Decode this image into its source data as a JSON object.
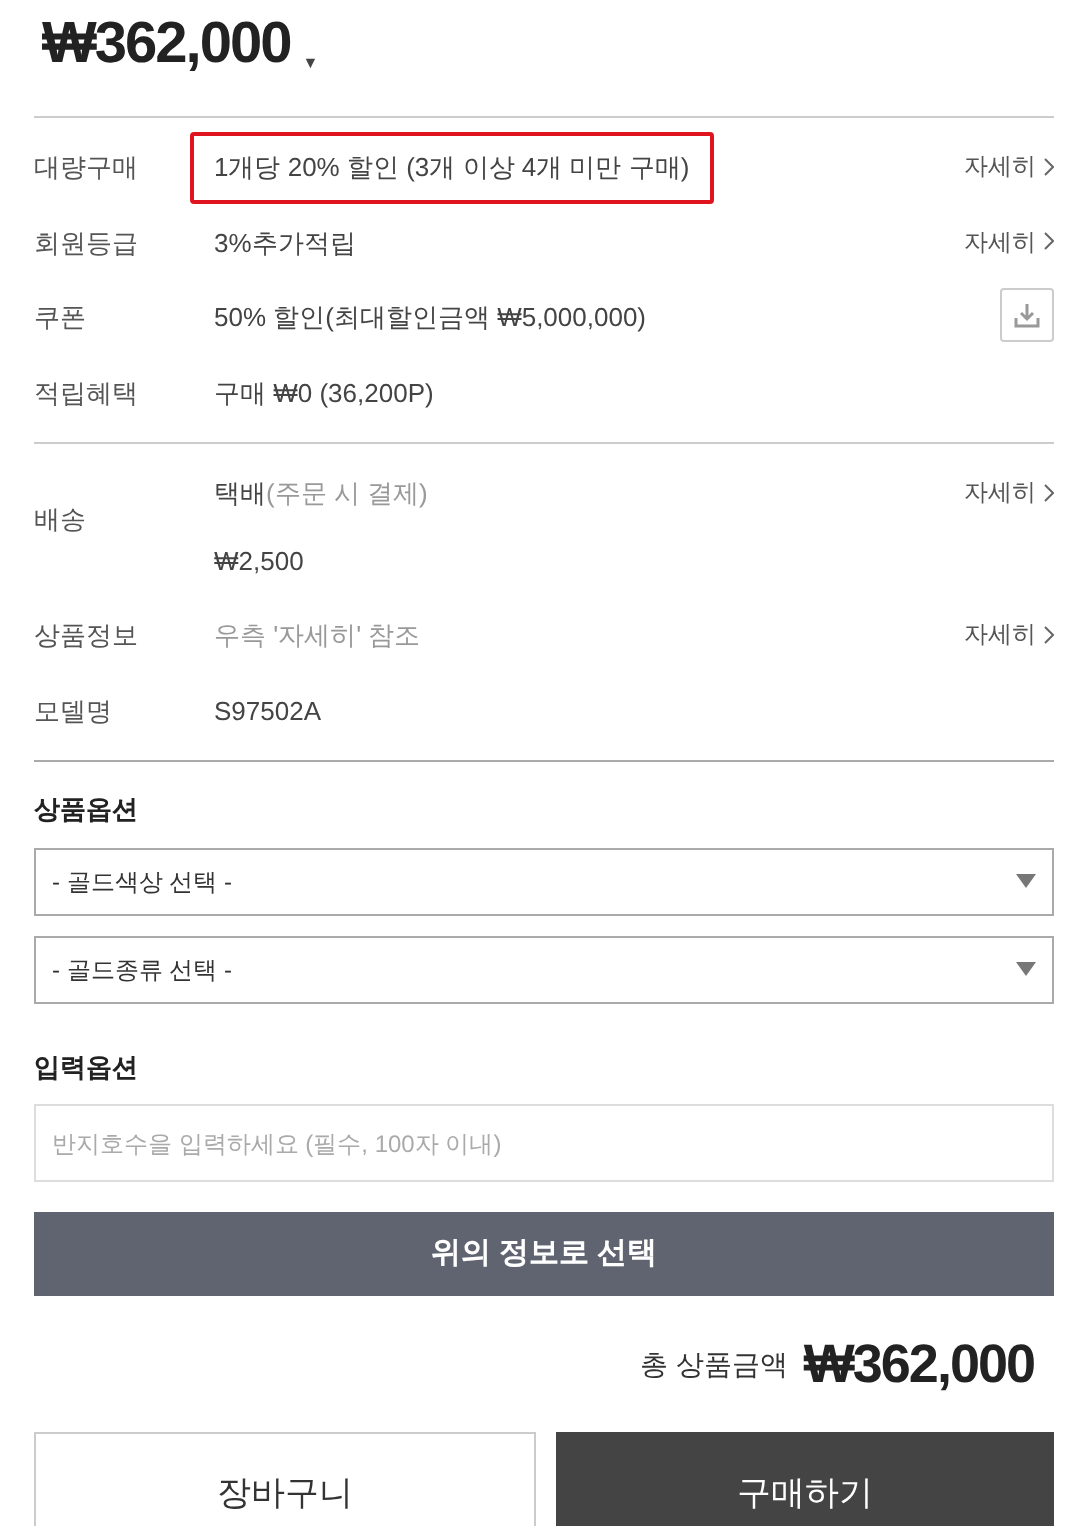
{
  "price": "₩362,000",
  "price_caret": "▼",
  "info_rows": [
    {
      "label": "대량구매",
      "kind": "text",
      "highlighted": true,
      "muted": false,
      "lines": [
        "1개당 20% 할인 (3개 이상 4개 미만 구매)"
      ],
      "detail": "자세히"
    },
    {
      "label": "회원등급",
      "kind": "text",
      "highlighted": false,
      "muted": false,
      "lines": [
        "3%추가적립"
      ],
      "detail": "자세히"
    },
    {
      "label": "쿠폰",
      "kind": "download",
      "highlighted": false,
      "muted": false,
      "lines": [
        "50% 할인(최대할인금액 ₩5,000,000)"
      ]
    },
    {
      "label": "적립혜택",
      "kind": "text",
      "highlighted": false,
      "muted": false,
      "lines": [
        "구매 ₩0 (36,200P)"
      ]
    }
  ],
  "info_rows_2": [
    {
      "label": "배송",
      "kind": "shipping",
      "highlighted": false,
      "muted": false,
      "method": "택배",
      "note": "(주문 시 결제)",
      "lines": [
        "₩2,500"
      ],
      "detail": "자세히"
    },
    {
      "label": "상품정보",
      "kind": "text",
      "highlighted": false,
      "muted": true,
      "lines": [
        "우측 '자세히' 참조"
      ],
      "detail": "자세히"
    },
    {
      "label": "모델명",
      "kind": "text",
      "highlighted": false,
      "muted": false,
      "lines": [
        "S97502A"
      ]
    }
  ],
  "product_options": {
    "title": "상품옵션",
    "selects": [
      "- 골드색상 선택 -",
      "- 골드종류 선택 -"
    ]
  },
  "input_options": {
    "title": "입력옵션",
    "placeholder": "반지호수을 입력하세요 (필수, 100자 이내)"
  },
  "select_button": "위의 정보로 선택",
  "total": {
    "label": "총 상품금액",
    "amount": "₩362,000"
  },
  "actions": [
    {
      "label": "장바구니",
      "kind": "secondary"
    },
    {
      "label": "구매하기",
      "kind": "primary"
    }
  ]
}
